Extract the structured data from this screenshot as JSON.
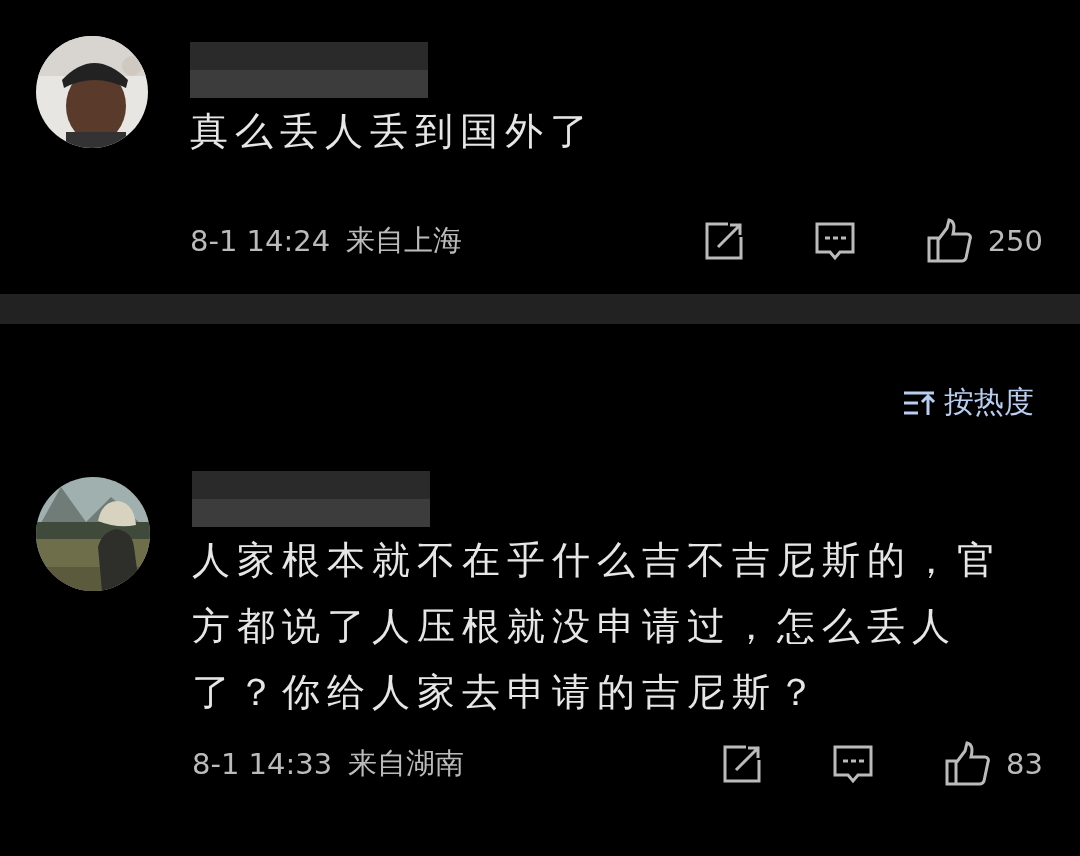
{
  "comment_top": {
    "text": "真么丢人丢到国外了",
    "time": "8-1 14:24",
    "location": "来自上海",
    "likes": "250"
  },
  "sort_label": "按热度",
  "comments": [
    {
      "text": "人家根本就不在乎什么吉不吉尼斯的，官方都说了人压根就没申请过，怎么丢人了？你给人家去申请的吉尼斯？",
      "time": "8-1 14:33",
      "location": "来自湖南",
      "likes": "83"
    }
  ]
}
